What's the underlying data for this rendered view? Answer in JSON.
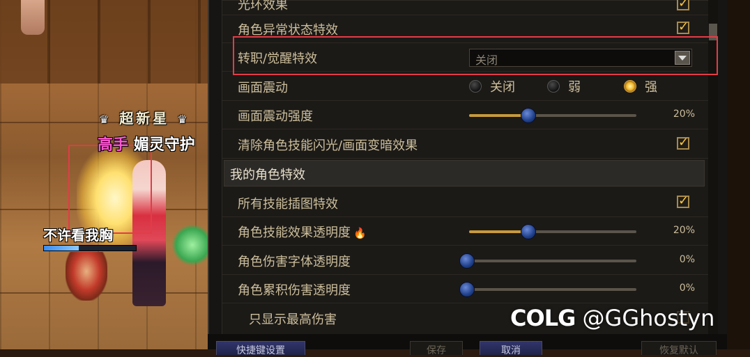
{
  "scene": {
    "guild_title": "超新星",
    "rank_label": "高手",
    "player_title": "媚灵守护",
    "pet_name": "不许看我胸",
    "pet_hp_fraction": 0.38
  },
  "settings": {
    "top_partial_label": "光环效果",
    "rows": [
      {
        "label": "角色异常状态特效",
        "checked": true
      },
      {
        "label": "转职/觉醒特效",
        "dropdown_value": "关闭"
      },
      {
        "label": "画面震动",
        "options": [
          "关闭",
          "弱",
          "强"
        ],
        "selected": "强"
      },
      {
        "label": "画面震动强度",
        "value": "20%",
        "fraction": 0.2
      },
      {
        "label": "清除角色技能闪光/画面变暗效果",
        "checked": true
      }
    ],
    "section_title": "我的角色特效",
    "section_rows": [
      {
        "label": "所有技能插图特效",
        "checked": true
      },
      {
        "label": "角色技能效果透明度",
        "value": "20%",
        "fraction": 0.2
      },
      {
        "label": "角色伤害字体透明度",
        "value": "0%",
        "fraction": 0
      },
      {
        "label": "角色累积伤害透明度",
        "value": "0%",
        "fraction": 0
      },
      {
        "label": "只显示最高伤害",
        "checked": false
      }
    ]
  },
  "bottom_bar": {
    "buttons": [
      "快捷键设置",
      "保存",
      "取消",
      "恢复默认"
    ]
  },
  "watermark": {
    "brand": "COLG",
    "handle": "@GGhostyn"
  }
}
